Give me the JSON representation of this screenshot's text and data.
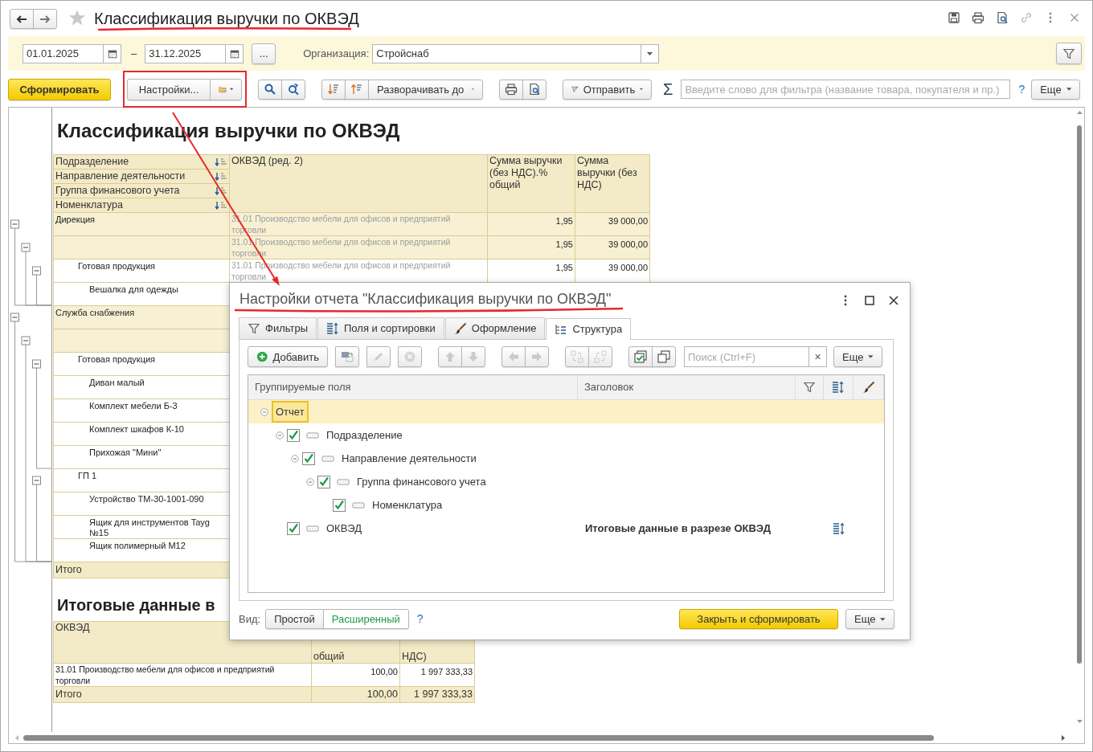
{
  "window": {
    "title": "Классификация выручки по ОКВЭД"
  },
  "filters": {
    "date_from": "01.01.2025",
    "separator": "–",
    "date_to": "31.12.2025",
    "period_button": "...",
    "organization_label": "Организация:",
    "organization": "Стройснаб"
  },
  "toolbar": {
    "generate_button": "Сформировать",
    "settings_button": "Настройки...",
    "expand_button": "Разворачивать до",
    "send_button": "Отправить",
    "sum_symbol": "Σ",
    "search": {
      "placeholder": "Введите слово для фильтра (название товара, покупателя и пр.)"
    },
    "help": "?",
    "more_button": "Еще"
  },
  "report": {
    "title": "Классификация выручки по ОКВЭД",
    "grouping_headers": [
      "Подразделение",
      "Направление деятельности",
      "Группа финансового учета",
      "Номенклатура"
    ],
    "columns": [
      "ОКВЭД (ред. 2)",
      "Сумма выручки (без НДС).% общий",
      "Сумма выручки (без НДС)"
    ],
    "rows": [
      {
        "label": "Дирекция",
        "okved": "31.01 Производство мебели для офисов и предприятий торговли",
        "percent": "1,95",
        "sum": "39 000,00",
        "expanded": true,
        "children": [
          {
            "okved": "31.01 Производство мебели для офисов и предприятий торговли",
            "percent": "1,95",
            "sum": "39 000,00",
            "expanded": true,
            "children": [
              {
                "label": "Готовая продукция",
                "okved": "31.01 Производство мебели для офисов и предприятий торговли",
                "percent": "1,95",
                "sum": "39 000,00",
                "expanded": true,
                "children": [
                  {
                    "label": "Вешалка для одежды"
                  }
                ]
              }
            ]
          }
        ]
      },
      {
        "label": "Служба снабжения",
        "expanded": true,
        "children": [
          {
            "expanded": true,
            "children": [
              {
                "label": "Готовая продукция",
                "expanded": true,
                "children": [
                  {
                    "label": "Диван малый"
                  },
                  {
                    "label": "Комплект мебели Б-3"
                  },
                  {
                    "label": "Комплект шкафов К-10"
                  },
                  {
                    "label": "Прихожая \"Мини\""
                  }
                ]
              },
              {
                "label": "ГП 1",
                "expanded": true,
                "children": [
                  {
                    "label": "Устройство ТМ-30-1001-090"
                  },
                  {
                    "label": "Ящик для инструментов Tayg №15"
                  },
                  {
                    "label": "Ящик полимерный М12"
                  }
                ]
              }
            ]
          }
        ]
      }
    ],
    "total": {
      "label": "Итого"
    },
    "summary": {
      "title": "Итоговые данные в",
      "columns": [
        "ОКВЭД",
        "общий",
        "НДС)"
      ],
      "rows": [
        {
          "okved": "31.01 Производство мебели для офисов и предприятий торговли",
          "percent": "100,00",
          "sum": "1 997 333,33"
        }
      ],
      "total": {
        "label": "Итого",
        "percent": "100,00",
        "sum": "1 997 333,33"
      }
    }
  },
  "dialog": {
    "title": "Настройки отчета \"Классификация выручки по ОКВЭД\"",
    "tabs": [
      {
        "label": "Фильтры",
        "kind": "filter",
        "selected": false
      },
      {
        "label": "Поля и сортировки",
        "kind": "fields",
        "selected": false
      },
      {
        "label": "Оформление",
        "kind": "design",
        "selected": false
      },
      {
        "label": "Структура",
        "kind": "structure",
        "selected": true
      }
    ],
    "add_button": "Добавить",
    "tool_groups": [
      [
        {
          "kind": "group",
          "disabled": false
        }
      ],
      [
        {
          "kind": "edit",
          "disabled": true
        }
      ],
      [
        {
          "kind": "delete",
          "disabled": true
        }
      ],
      [
        {
          "kind": "up",
          "disabled": true
        },
        {
          "kind": "down",
          "disabled": true
        }
      ],
      [
        {
          "kind": "left",
          "disabled": true
        },
        {
          "kind": "right",
          "disabled": true
        }
      ],
      [
        {
          "kind": "swap_in",
          "disabled": true
        },
        {
          "kind": "swap_out",
          "disabled": true
        }
      ],
      [
        {
          "kind": "check_all",
          "disabled": false
        },
        {
          "kind": "copy",
          "disabled": false
        }
      ]
    ],
    "search": {
      "placeholder": "Поиск (Ctrl+F)",
      "clear": "×"
    },
    "more_button": "Еще",
    "columns": [
      "Группируемые поля",
      "Заголовок"
    ],
    "tree": [
      {
        "label": "Отчет",
        "selected": true,
        "expanded": true,
        "children": [
          {
            "label": "Подразделение",
            "checked": true,
            "selected": false,
            "expanded": true,
            "children": [
              {
                "label": "Направление деятельности",
                "checked": true,
                "selected": false,
                "expanded": true,
                "children": [
                  {
                    "label": "Группа финансового учета",
                    "checked": true,
                    "selected": false,
                    "expanded": true,
                    "children": [
                      {
                        "label": "Номенклатура",
                        "checked": true,
                        "selected": false
                      }
                    ]
                  }
                ]
              }
            ]
          },
          {
            "label": "ОКВЭД",
            "checked": true,
            "selected": false,
            "heading": "Итоговые данные в разрезе ОКВЭД",
            "has_fields": true
          }
        ]
      }
    ],
    "view_label": "Вид:",
    "views": [
      {
        "label": "Простой",
        "selected": false
      },
      {
        "label": "Расширенный",
        "selected": true
      }
    ],
    "help": "?",
    "close_button": "Закрыть и сформировать",
    "footer_more": "Еще"
  }
}
